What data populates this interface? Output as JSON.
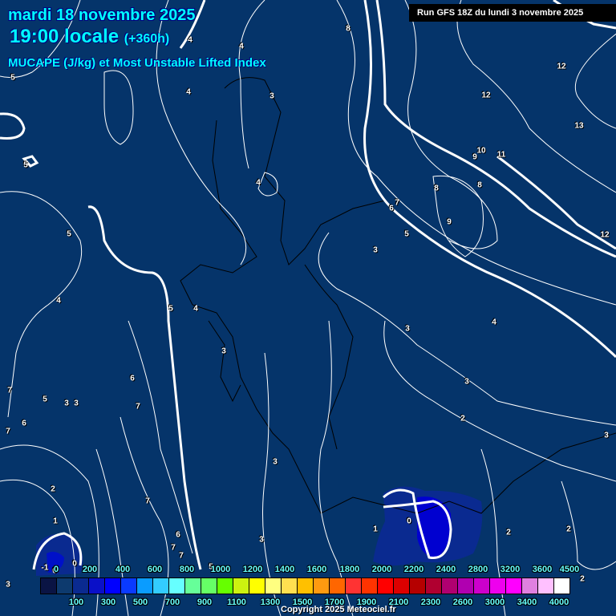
{
  "header": {
    "date": "mardi 18 novembre 2025",
    "time": "19:00 locale",
    "offset": "(+360h)",
    "title": "MUCAPE (J/kg) et Most Unstable Lifted Index",
    "run": "Run GFS 18Z du lundi 3 novembre 2025"
  },
  "legend": {
    "top_labels": [
      "0",
      "200",
      "400",
      "600",
      "800",
      "1000",
      "1200",
      "1400",
      "1600",
      "1800",
      "2000",
      "2200",
      "2400",
      "2800",
      "3200",
      "3600",
      "4500"
    ],
    "bottom_labels": [
      "100",
      "300",
      "500",
      "700",
      "900",
      "1100",
      "1300",
      "1500",
      "1700",
      "1900",
      "2100",
      "2300",
      "2600",
      "3000",
      "3400",
      "4000"
    ],
    "colors": [
      "#0a1444",
      "#0d3a6e",
      "#0a2a90",
      "#0a10c8",
      "#0000ff",
      "#0a3aff",
      "#0a9cff",
      "#33ccff",
      "#66ffff",
      "#66ff99",
      "#66ff66",
      "#66ff00",
      "#ccf210",
      "#ffff00",
      "#ffff80",
      "#ffe050",
      "#ffc000",
      "#ff9a10",
      "#ff6600",
      "#ff3333",
      "#ff3300",
      "#ff0000",
      "#dd0000",
      "#b50000",
      "#b00030",
      "#b00070",
      "#b000b0",
      "#cc00cc",
      "#ee00ee",
      "#ff00ff",
      "#e080e0",
      "#ffc0ff",
      "#ffffff"
    ]
  },
  "contour_labels": [
    "4",
    "4",
    "5",
    "4",
    "3",
    "8",
    "12",
    "12",
    "13",
    "10",
    "9",
    "11",
    "5",
    "4",
    "8",
    "8",
    "7",
    "6",
    "9",
    "5",
    "12",
    "5",
    "3",
    "4",
    "5",
    "4",
    "3",
    "4",
    "3",
    "6",
    "3",
    "7",
    "5",
    "3",
    "3",
    "7",
    "6",
    "2",
    "7",
    "3",
    "3",
    "2",
    "7",
    "1",
    "1",
    "0",
    "6",
    "2",
    "2",
    "3",
    "7",
    "7",
    "-1",
    "0",
    "0",
    "5",
    "2",
    "3"
  ],
  "copyright": "Copyright 2025 Meteociel.fr",
  "colors": {
    "background": "#05346a",
    "title": "#00ffff"
  }
}
